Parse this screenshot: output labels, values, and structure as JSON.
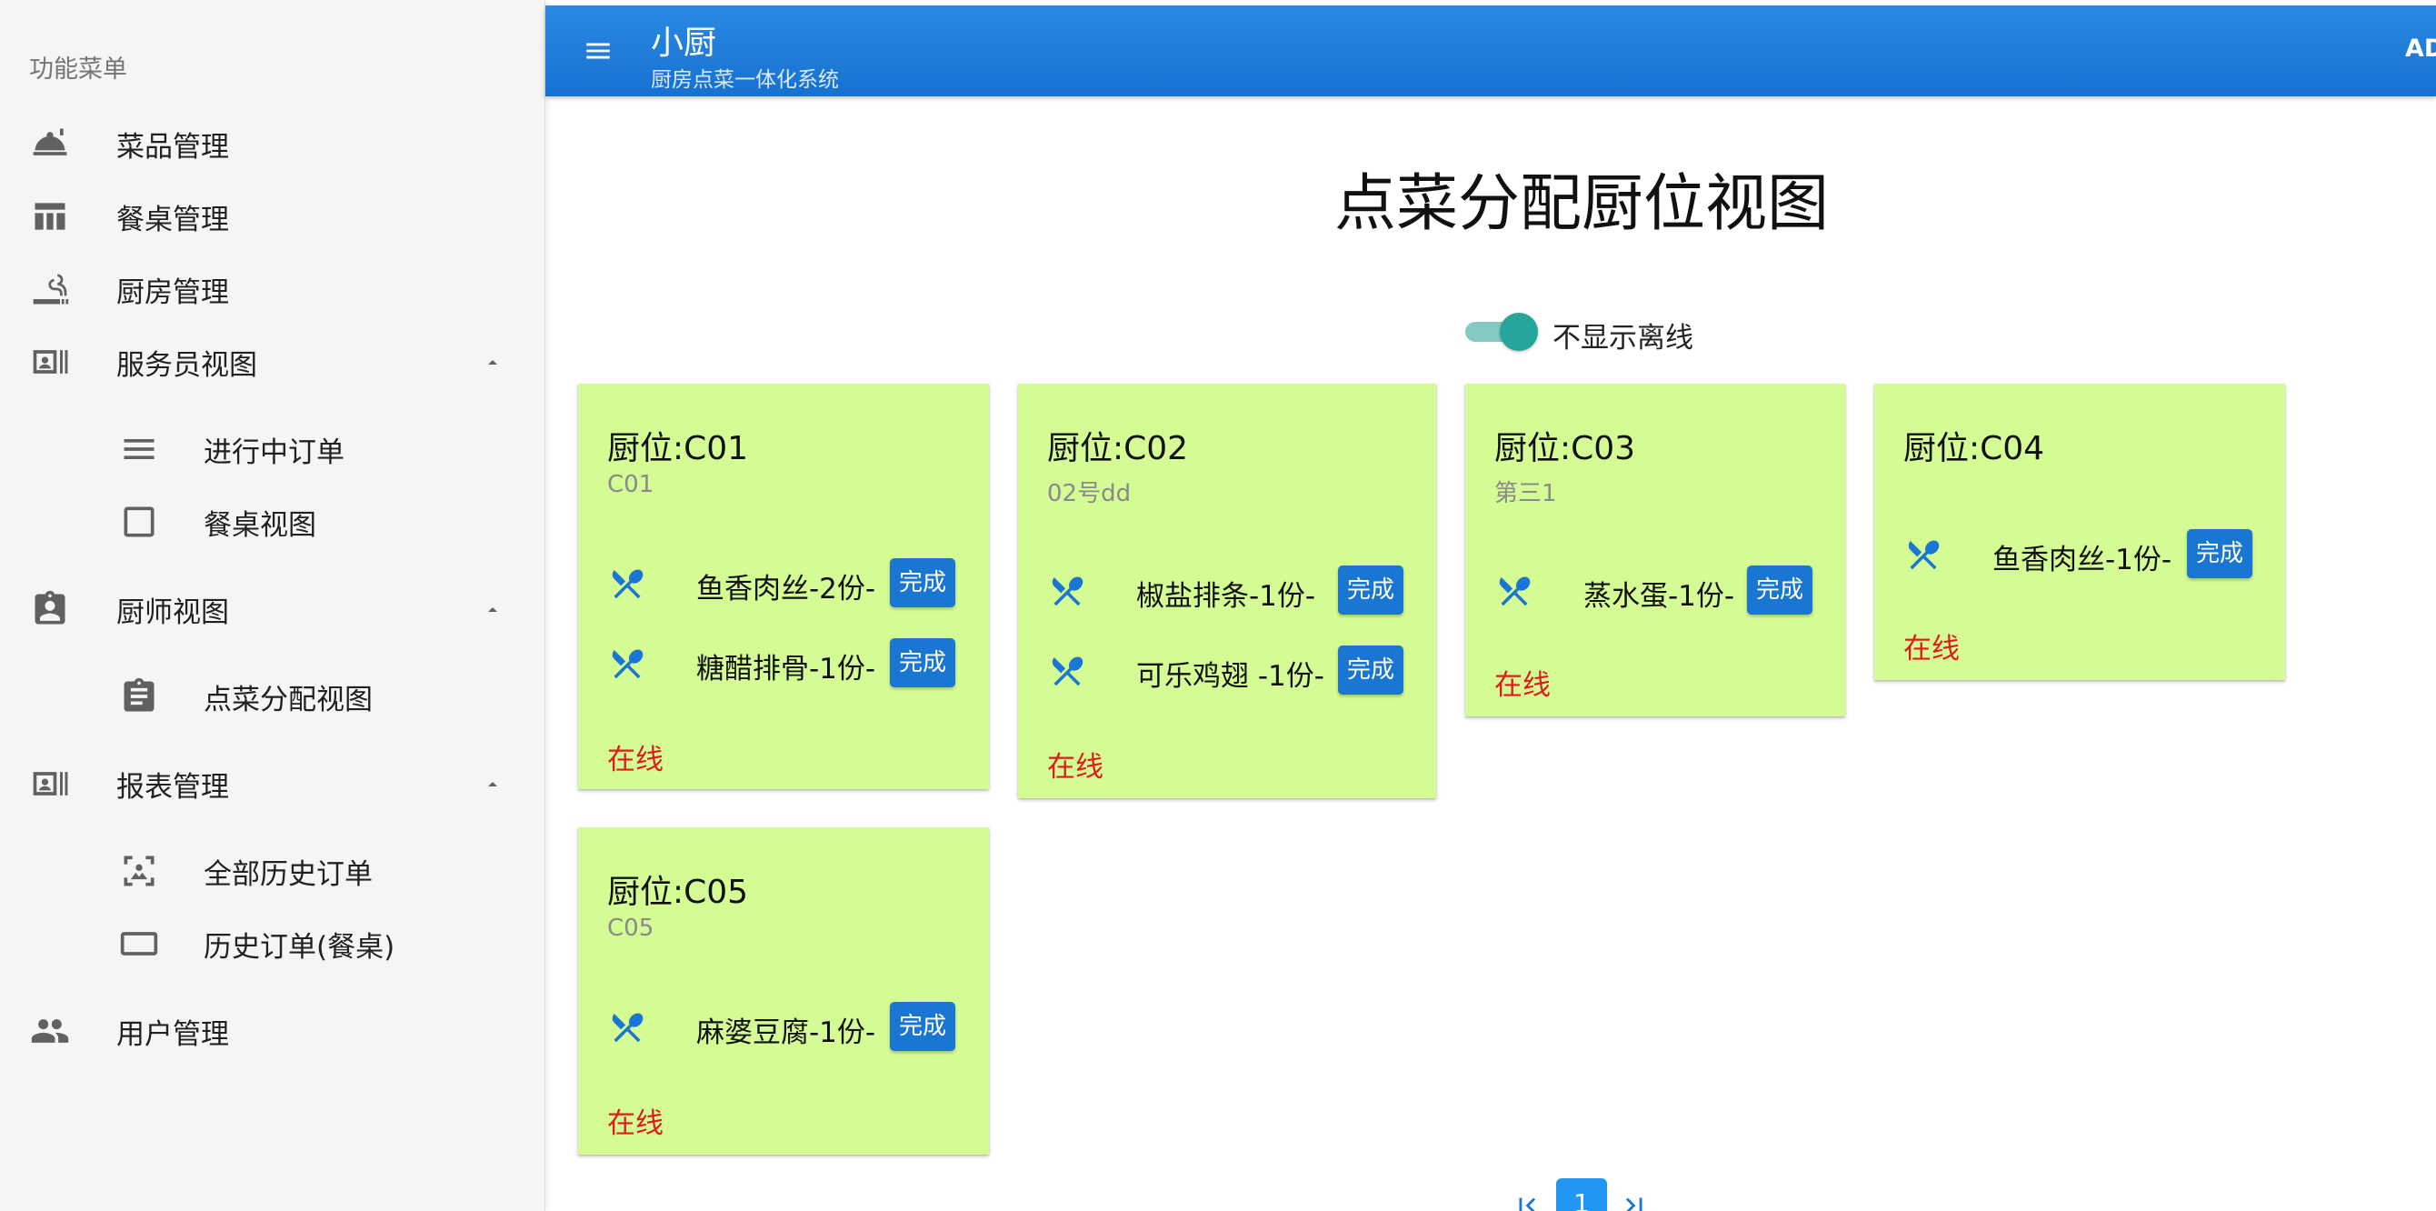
{
  "sidebar": {
    "header": "功能菜单",
    "items": [
      {
        "label": "菜品管理",
        "icon": "dish-tray-icon"
      },
      {
        "label": "餐桌管理",
        "icon": "table-icon"
      },
      {
        "label": "厨房管理",
        "icon": "kitchen-icon"
      },
      {
        "label": "服务员视图",
        "icon": "badge-icon",
        "expanded": true,
        "children": [
          {
            "label": "进行中订单",
            "icon": "list-lines-icon"
          },
          {
            "label": "餐桌视图",
            "icon": "square-outline-icon"
          }
        ]
      },
      {
        "label": "厨师视图",
        "icon": "clipboard-person-icon",
        "expanded": true,
        "children": [
          {
            "label": "点菜分配视图",
            "icon": "clipboard-text-icon"
          }
        ]
      },
      {
        "label": "报表管理",
        "icon": "badge-icon",
        "expanded": true,
        "children": [
          {
            "label": "全部历史订单",
            "icon": "image-frame-icon"
          },
          {
            "label": "历史订单(餐桌)",
            "icon": "rectangle-outline-icon"
          }
        ]
      },
      {
        "label": "用户管理",
        "icon": "people-icon"
      }
    ]
  },
  "appbar": {
    "title": "小厨",
    "subtitle": "厨房点菜一体化系统",
    "user": "AD"
  },
  "main": {
    "title": "点菜分配厨位视图",
    "toggle": {
      "label": "不显示离线",
      "on": true
    },
    "done_label": "完成",
    "stations": [
      {
        "title": "厨位:C01",
        "subtitle": "C01",
        "dishes": [
          "鱼香肉丝-2份-",
          "糖醋排骨-1份-"
        ],
        "status": "在线"
      },
      {
        "title": "厨位:C02",
        "subtitle": "02号dd",
        "dishes": [
          "椒盐排条-1份-",
          "可乐鸡翅 -1份-"
        ],
        "status": "在线"
      },
      {
        "title": "厨位:C03",
        "subtitle": "第三1",
        "dishes": [
          "蒸水蛋-1份-"
        ],
        "status": "在线"
      },
      {
        "title": "厨位:C04",
        "subtitle": "",
        "dishes": [
          "鱼香肉丝-1份-"
        ],
        "status": "在线"
      },
      {
        "title": "厨位:C05",
        "subtitle": "C05",
        "dishes": [
          "麻婆豆腐-1份-"
        ],
        "status": "在线"
      }
    ],
    "pagination": {
      "current": "1"
    }
  },
  "colors": {
    "appbar": "#1976d2",
    "card": "#d4fb94",
    "status_online": "#e01b1b",
    "toggle": "#26a69a"
  }
}
